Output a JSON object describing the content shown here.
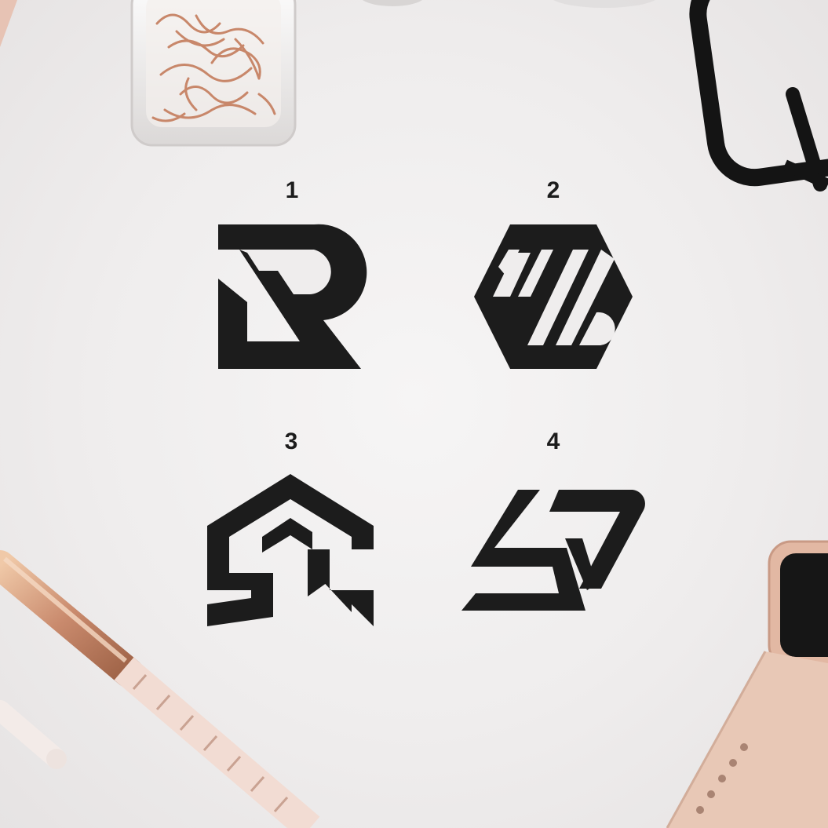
{
  "options": [
    {
      "number": "1"
    },
    {
      "number": "2"
    },
    {
      "number": "3"
    },
    {
      "number": "4"
    }
  ],
  "colors": {
    "background": "#efeded",
    "logo": "#1c1c1c",
    "rose_gold": "#c98a6d",
    "strap": "#e8c8b6"
  }
}
